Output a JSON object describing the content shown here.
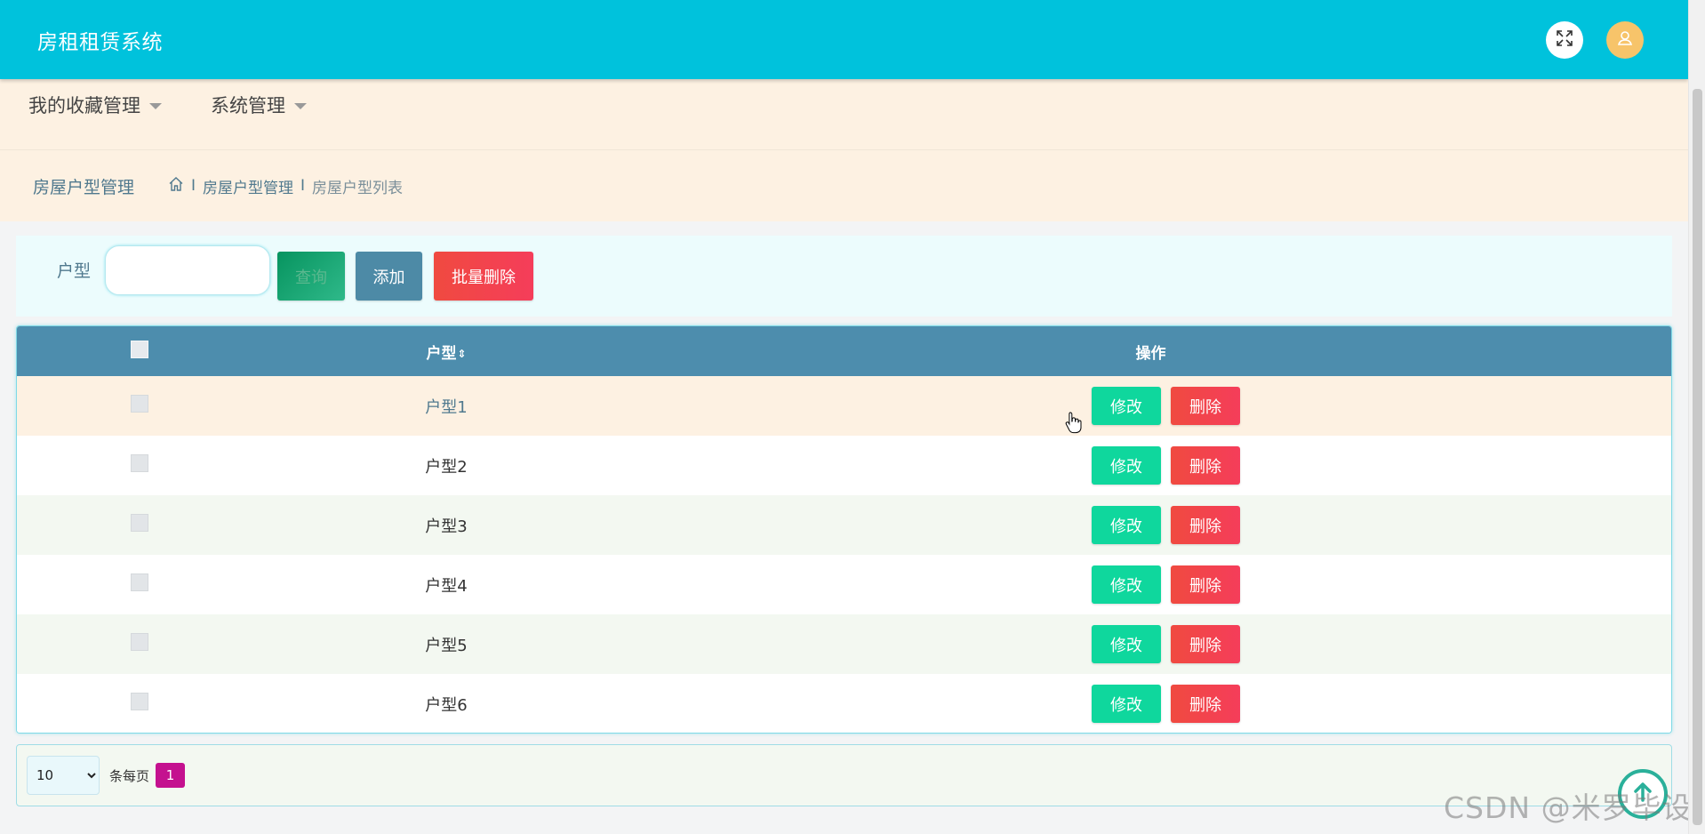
{
  "header": {
    "title": "房租租赁系统",
    "fullscreen_icon": "fullscreen-icon",
    "avatar_icon": "user-icon",
    "bg_color": "#00c2dc"
  },
  "menu": {
    "items": [
      {
        "label": "我的收藏管理"
      },
      {
        "label": "系统管理"
      }
    ]
  },
  "breadcrumb": {
    "page_title": "房屋户型管理",
    "home_icon": "home-icon",
    "sep": "I",
    "level1": "房屋户型管理",
    "current": "房屋户型列表"
  },
  "search": {
    "label": "户型",
    "value": "",
    "search_button": "查询",
    "add_button": "添加",
    "batch_delete_button": "批量删除"
  },
  "table": {
    "columns": {
      "name": "户型",
      "sort_icon": "⇕",
      "action": "操作"
    },
    "rows": [
      {
        "name": "户型1"
      },
      {
        "name": "户型2"
      },
      {
        "name": "户型3"
      },
      {
        "name": "户型4"
      },
      {
        "name": "户型5"
      },
      {
        "name": "户型6"
      }
    ],
    "edit_label": "修改",
    "delete_label": "删除"
  },
  "pagination": {
    "page_size": "10",
    "page_size_options": [
      "10"
    ],
    "per_page_label": "条每页",
    "current_page": "1"
  },
  "watermark": "CSDN @米罗毕设",
  "colors": {
    "accent": "#00c2dc",
    "edit": "#0fd79d",
    "delete": "#f04a40",
    "table_header": "#4d8dad",
    "page_active": "#c4118f"
  }
}
